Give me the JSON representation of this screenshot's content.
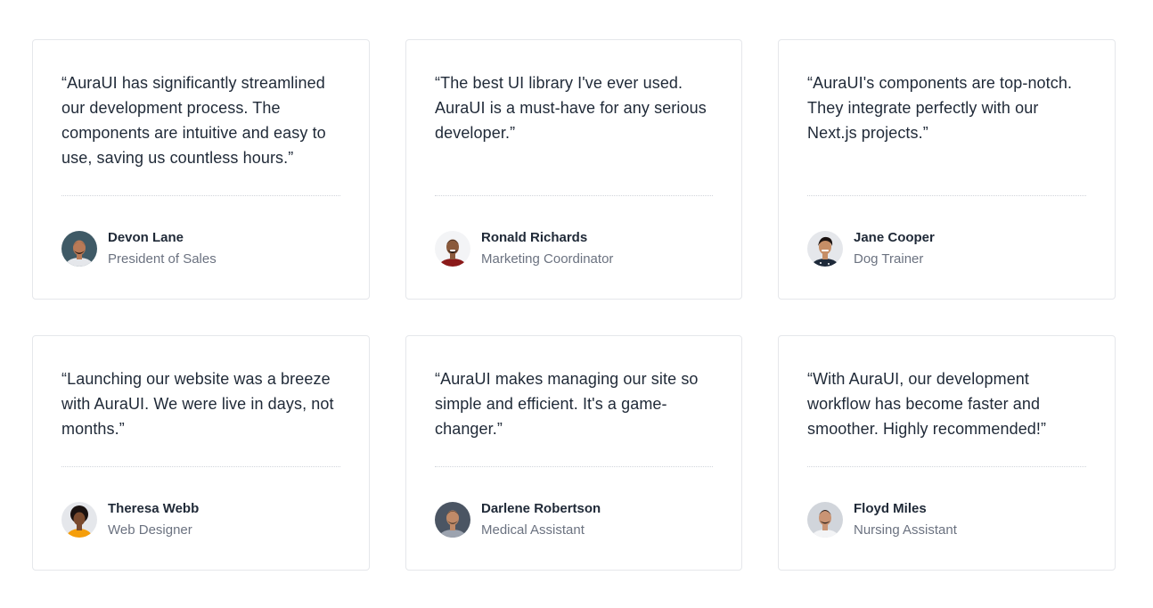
{
  "testimonials": [
    {
      "quote": "“AuraUI has significantly streamlined our development process. The components are intuitive and easy to use, saving us countless hours.”",
      "name": "Devon Lane",
      "role": "President of Sales"
    },
    {
      "quote": "“The best UI library I've ever used. AuraUI is a must-have for any serious developer.”",
      "name": "Ronald Richards",
      "role": "Marketing Coordinator"
    },
    {
      "quote": "“AuraUI's components are top-notch. They integrate perfectly with our Next.js projects.”",
      "name": "Jane Cooper",
      "role": "Dog Trainer"
    },
    {
      "quote": "“Launching our website was a breeze with AuraUI. We were live in days, not months.”",
      "name": "Theresa Webb",
      "role": "Web Designer"
    },
    {
      "quote": "“AuraUI makes managing our site so simple and efficient. It's a game-changer.”",
      "name": "Darlene Robertson",
      "role": "Medical Assistant"
    },
    {
      "quote": "“With AuraUI, our development workflow has become faster and smoother. Highly recommended!”",
      "name": "Floyd Miles",
      "role": "Nursing Assistant"
    }
  ],
  "colors": {
    "text": "#1f2937",
    "muted": "#6b7280",
    "border": "#e5e7eb"
  }
}
